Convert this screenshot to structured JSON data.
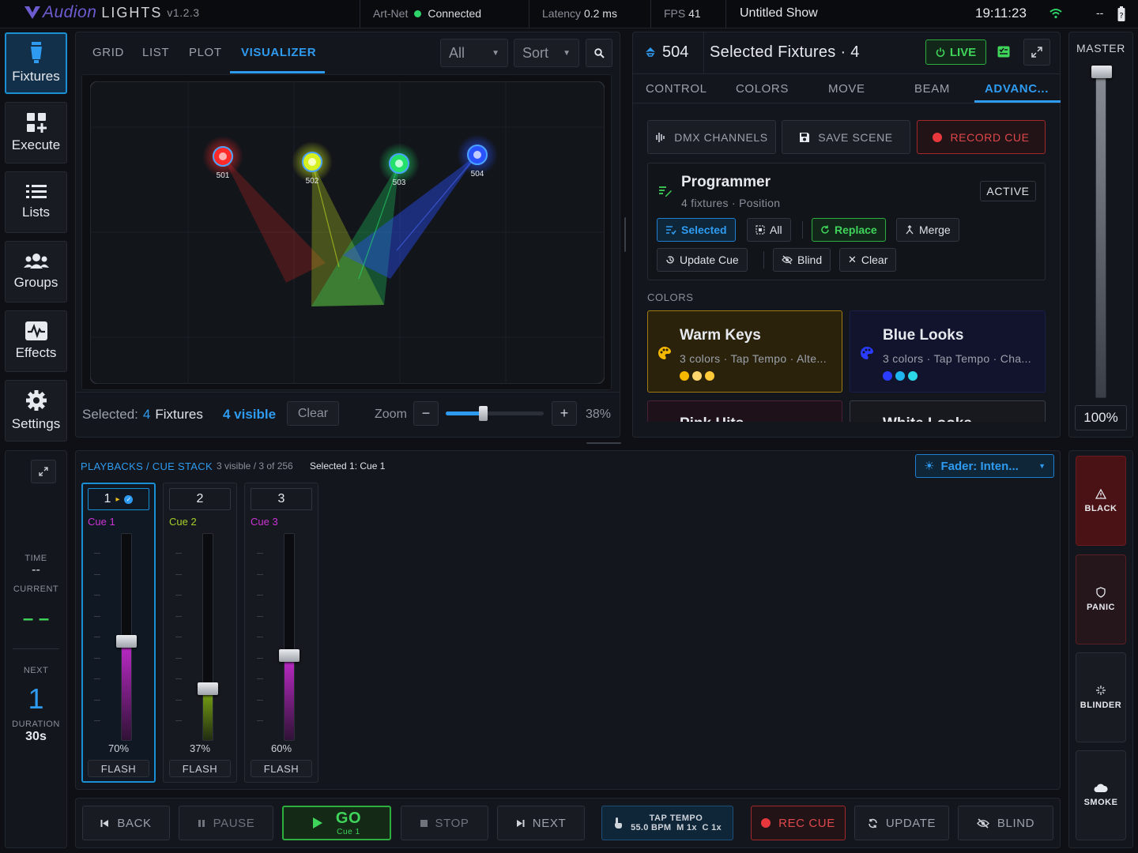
{
  "app": {
    "logo_main": "Audion",
    "logo_sub": "LIGHTS",
    "version": "v1.2.3"
  },
  "status": {
    "artnet_label": "Art-Net",
    "artnet_state": "Connected",
    "latency_label": "Latency",
    "latency_value": "0.2 ms",
    "fps_label": "FPS",
    "fps_value": "41",
    "show_name": "Untitled Show",
    "clock": "19:11:23",
    "battery": "--"
  },
  "nav": [
    {
      "label": "Fixtures",
      "icon": "fixture-icon"
    },
    {
      "label": "Execute",
      "icon": "grid-plus-icon"
    },
    {
      "label": "Lists",
      "icon": "list-icon"
    },
    {
      "label": "Groups",
      "icon": "users-icon"
    },
    {
      "label": "Effects",
      "icon": "waveform-icon"
    },
    {
      "label": "Settings",
      "icon": "gear-icon"
    }
  ],
  "view_tabs": [
    "GRID",
    "LIST",
    "PLOT",
    "VISUALIZER"
  ],
  "filter": {
    "value": "All"
  },
  "sort": {
    "value": "Sort"
  },
  "fixtures": [
    {
      "id": "501",
      "color": "#ff2a2a"
    },
    {
      "id": "502",
      "color": "#d6f020"
    },
    {
      "id": "503",
      "color": "#22e06a"
    },
    {
      "id": "504",
      "color": "#2a52ff"
    }
  ],
  "viz_footer": {
    "selected_label": "Selected:",
    "selected_count": "4",
    "selected_unit": "Fixtures",
    "visible": "4 visible",
    "clear": "Clear",
    "zoom_label": "Zoom",
    "zoom_value": "38%",
    "zoom_level": 0.38
  },
  "selection": {
    "id": "504",
    "title": "Selected Fixtures · 4",
    "live": "LIVE"
  },
  "detail_tabs": [
    "CONTROL",
    "COLORS",
    "MOVE",
    "BEAM",
    "ADVANC..."
  ],
  "actions": {
    "dmx": "DMX CHANNELS",
    "save": "SAVE SCENE",
    "record": "RECORD CUE"
  },
  "programmer": {
    "title": "Programmer",
    "sub": "4 fixtures · Position",
    "state": "ACTIVE",
    "selected": "Selected",
    "all": "All",
    "replace": "Replace",
    "merge": "Merge",
    "update": "Update Cue",
    "blind": "Blind",
    "clear": "Clear"
  },
  "colors": {
    "heading": "COLORS",
    "cards": [
      {
        "title": "Warm Keys",
        "sub": "3 colors · Tap Tempo · Alte...",
        "dots": [
          "#f5b800",
          "#ffd66e",
          "#ffc93a"
        ]
      },
      {
        "title": "Blue Looks",
        "sub": "3 colors · Tap Tempo · Cha...",
        "dots": [
          "#2a3cff",
          "#1fb6f0",
          "#2ad8e8"
        ]
      },
      {
        "title": "Pink Hits"
      },
      {
        "title": "White Looks"
      }
    ]
  },
  "master": {
    "label": "MASTER",
    "value": "100%",
    "level": 1.0
  },
  "playbacks": {
    "title": "PLAYBACKS / CUE STACK",
    "count": "3 visible / 3 of 256",
    "selected": "Selected 1: Cue 1",
    "fader_mode": "Fader: Inten...",
    "cues": [
      {
        "num": "1",
        "name": "Cue 1",
        "pct": "70%",
        "level": 0.7,
        "flash": "FLASH",
        "color": "#c42bcf"
      },
      {
        "num": "2",
        "name": "Cue 2",
        "pct": "37%",
        "level": 0.37,
        "flash": "FLASH",
        "color": "#7fae14"
      },
      {
        "num": "3",
        "name": "Cue 3",
        "pct": "60%",
        "level": 0.6,
        "flash": "FLASH",
        "color": "#c42bcf"
      }
    ]
  },
  "cue_info": {
    "time_label": "TIME",
    "time_value": "--",
    "current_label": "CURRENT",
    "current_value": "– –",
    "next_label": "NEXT",
    "next_value": "1",
    "duration_label": "DURATION",
    "duration_value": "30s"
  },
  "side": {
    "black": "BLACK",
    "panic": "PANIC",
    "blinder": "BLINDER",
    "smoke": "SMOKE"
  },
  "transport": {
    "back": "BACK",
    "pause": "PAUSE",
    "go": "GO",
    "go_sub": "Cue 1",
    "stop": "STOP",
    "next": "NEXT",
    "tap_title": "TAP TEMPO",
    "tap_sub": "55.0 BPM  M 1x  C 1x",
    "rec": "REC CUE",
    "update": "UPDATE",
    "blind": "BLIND"
  }
}
